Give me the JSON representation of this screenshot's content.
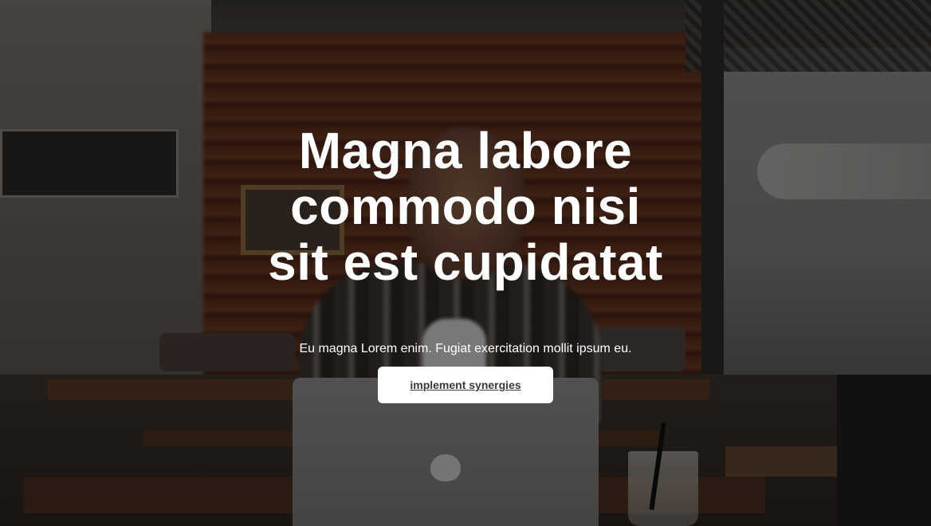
{
  "hero": {
    "headline": "Magna labore commodo nisi sit est cupidatat",
    "subtitle": "Eu magna Lorem enim. Fugiat exercitation mollit ipsum eu.",
    "cta_label": "implement synergies"
  },
  "background": {
    "description_icon": "cafe-photo",
    "overlay_color": "#000000"
  },
  "colors": {
    "text": "#ffffff",
    "button_bg": "#ffffff",
    "button_text": "#3a3a3a"
  }
}
